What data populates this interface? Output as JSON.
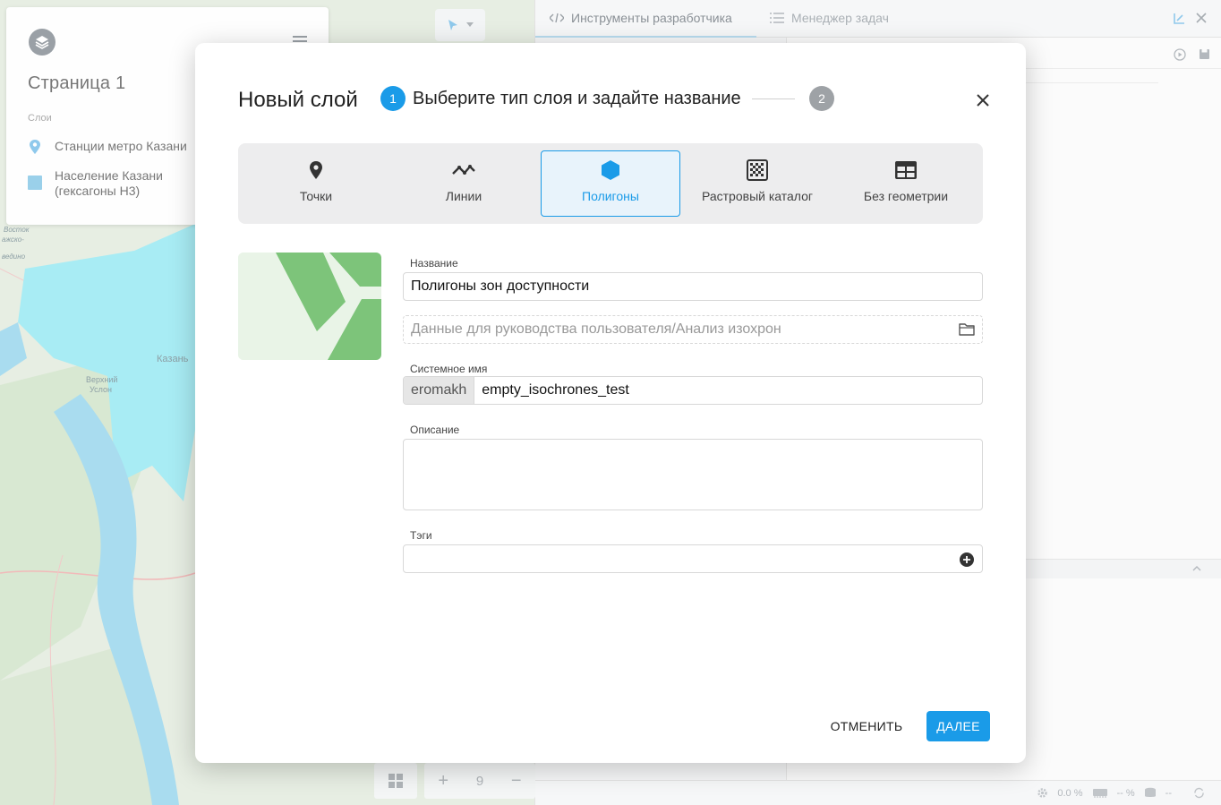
{
  "left_panel": {
    "page_title": "Страница 1",
    "layers_label": "Слои",
    "layers": [
      {
        "name": "Станции метро Казани",
        "icon": "map-pin-icon"
      },
      {
        "name": "Население Казани (гексагоны H3)",
        "icon": "hexagon-square-icon"
      }
    ]
  },
  "map": {
    "labels": [
      "Казань",
      "Верхний",
      "Услон",
      "Восток",
      "ажско-",
      "ведино"
    ]
  },
  "dev_panel": {
    "tabs": [
      {
        "label": "Инструменты разработчика",
        "icon": "code-icon"
      },
      {
        "label": "Менеджер задач",
        "icon": "list-icon"
      }
    ],
    "status": {
      "cpu": "0.0 %",
      "mem": "-- %",
      "db": "--"
    }
  },
  "bottom_controls": {
    "zoom_level": "9"
  },
  "modal": {
    "title": "Новый слой",
    "step1_number": "1",
    "step1_label": "Выберите тип слоя и задайте название",
    "step2_number": "2",
    "layer_types": [
      {
        "label": "Точки",
        "icon": "map-pin-icon"
      },
      {
        "label": "Линии",
        "icon": "polyline-icon"
      },
      {
        "label": "Полигоны",
        "icon": "hexagon-icon",
        "selected": true
      },
      {
        "label": "Растровый каталог",
        "icon": "raster-grid-icon"
      },
      {
        "label": "Без геометрии",
        "icon": "table-icon"
      }
    ],
    "name_label": "Название",
    "name_value": "Полигоны зон доступности",
    "folder_placeholder": "Данные для руководства пользователя/Анализ изохрон",
    "system_name_label": "Системное имя",
    "system_name_prefix": "eromakh",
    "system_name_value": "empty_isochrones_test",
    "description_label": "Описание",
    "description_value": "",
    "tags_label": "Тэги",
    "cancel_label": "ОТМЕНИТЬ",
    "next_label": "ДАЛЕЕ"
  },
  "colors": {
    "accent": "#1a9be8",
    "polygon_preview": "#7dc47a",
    "map_water": "#a9dcef",
    "map_coverage": "#a8ecf4"
  }
}
